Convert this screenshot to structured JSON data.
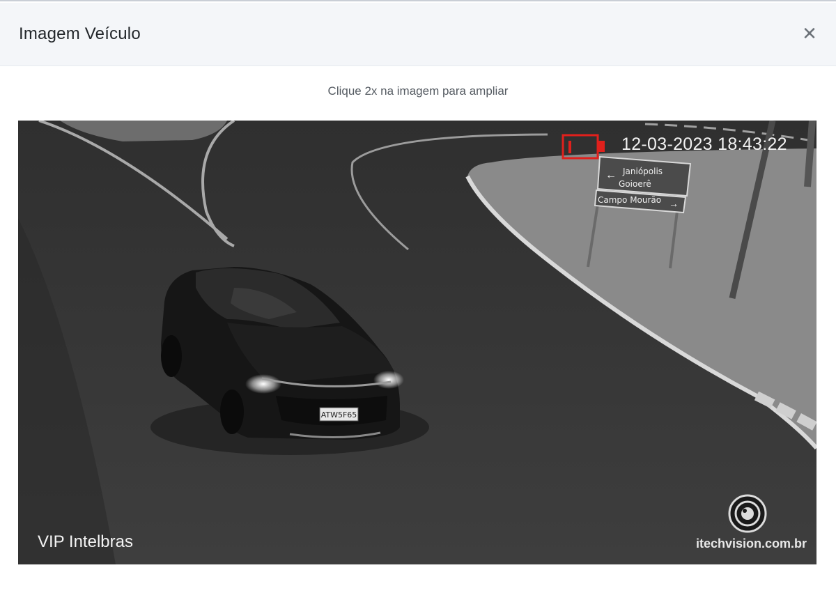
{
  "modal": {
    "title": "Imagem Veículo",
    "close_glyph": "✕",
    "hint": "Clique 2x na imagem para ampliar"
  },
  "photo": {
    "timestamp": "12-03-2023 18:43:22",
    "camera_brand": "VIP Intelbras",
    "watermark": "itechvision.com.br",
    "plate": "ATW5F65",
    "sign": {
      "line1": "Janiópolis",
      "line2": "Goioerê",
      "line3": "Campo Mourão"
    },
    "marker_color": "#e0201c"
  }
}
